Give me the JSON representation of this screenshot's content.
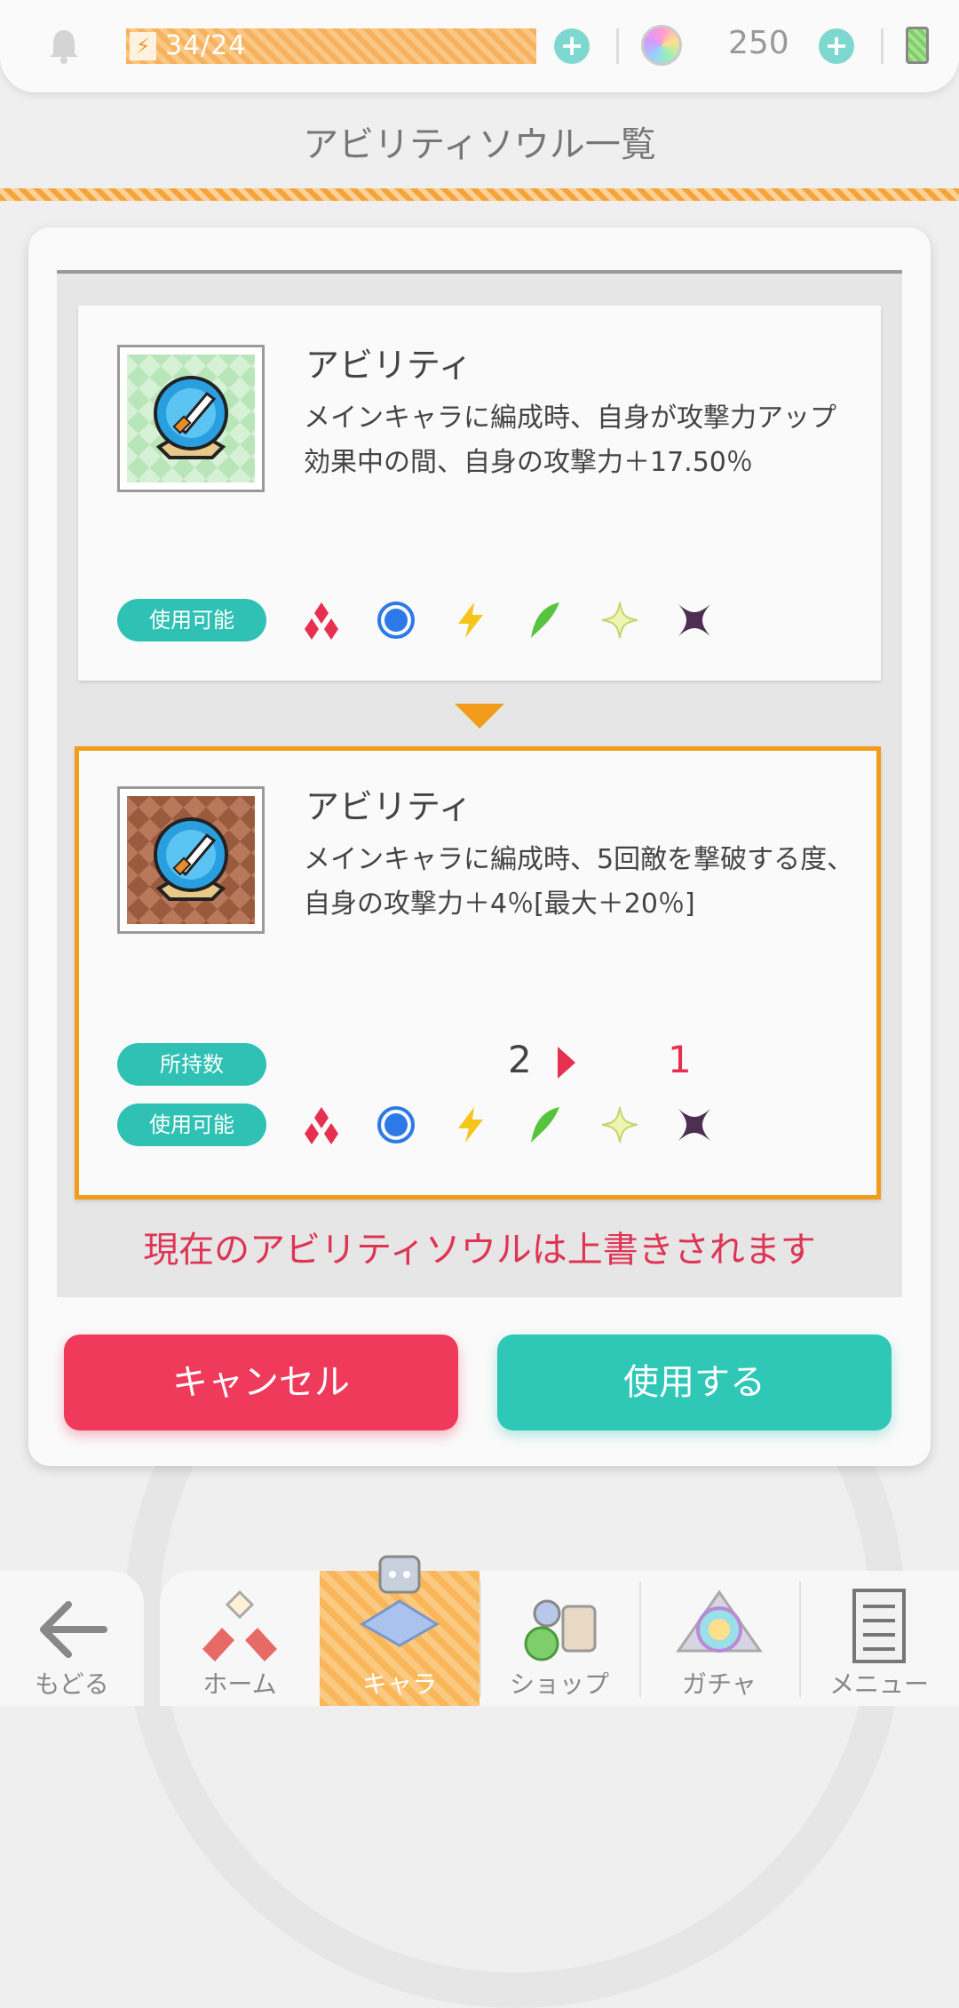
{
  "status_bar": {
    "stamina": "34/24",
    "gem_count": "250"
  },
  "page": {
    "title": "アビリティソウル一覧"
  },
  "current_ability": {
    "title": "アビリティ",
    "description": "メインキャラに編成時、自身が攻撃力アップ効果中の間、自身の攻撃力＋17.50％",
    "usable_label": "使用可能",
    "attributes": [
      "fire",
      "water",
      "thunder",
      "wind",
      "light",
      "dark"
    ]
  },
  "new_ability": {
    "title": "アビリティ",
    "description": "メインキャラに編成時、5回敵を撃破する度、自身の攻撃力＋4％[最大＋20％]",
    "owned_label": "所持数",
    "owned_before": "2",
    "owned_after": "1",
    "usable_label": "使用可能",
    "attributes": [
      "fire",
      "water",
      "thunder",
      "wind",
      "light",
      "dark"
    ]
  },
  "warning": "現在のアビリティソウルは上書きされます",
  "buttons": {
    "cancel": "キャンセル",
    "use": "使用する"
  },
  "nav": {
    "back": "もどる",
    "home": "ホーム",
    "chara": "キャラ",
    "shop": "ショップ",
    "gacha": "ガチャ",
    "menu": "メニュー",
    "active": "chara"
  },
  "colors": {
    "accent_orange": "#f39b1a",
    "teal": "#2fc1b3",
    "red": "#ef3a5b"
  }
}
